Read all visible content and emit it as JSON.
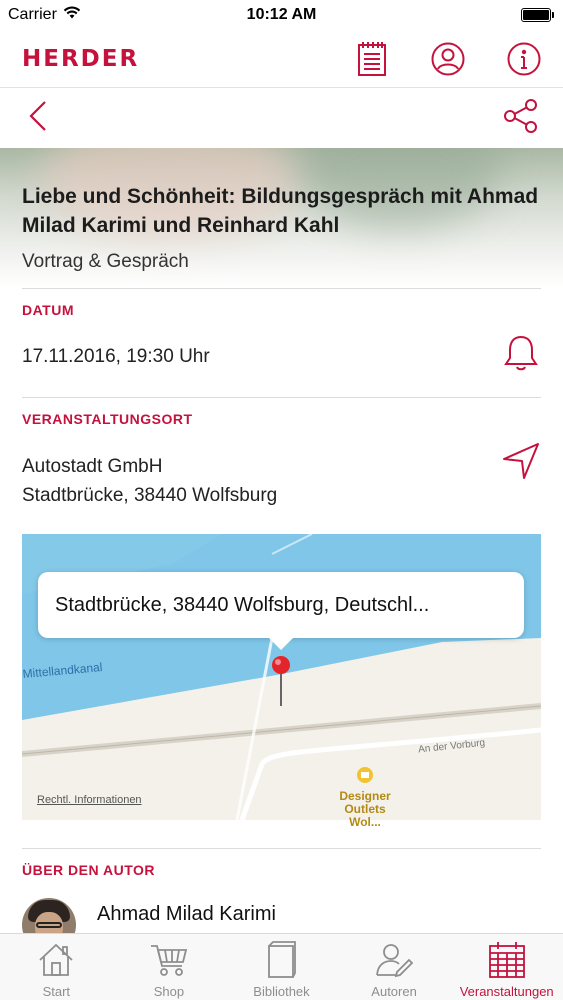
{
  "status_bar": {
    "carrier": "Carrier",
    "time": "10:12 AM",
    "battery_level": 1.0
  },
  "app_bar": {
    "logo": "HERDER",
    "icons": [
      "notepad-icon",
      "profile-icon",
      "info-icon"
    ]
  },
  "nav": {
    "icons": [
      "back-chevron-icon",
      "share-icon"
    ]
  },
  "event": {
    "title": "Liebe und Schönheit: Bildungsgespräch mit Ahmad Milad Karimi und Reinhard Kahl",
    "type": "Vortrag & Gespräch"
  },
  "date_section": {
    "label": "DATUM",
    "value": "17.11.2016, 19:30 Uhr",
    "icon": "bell-icon"
  },
  "venue_section": {
    "label": "VERANSTALTUNGSORT",
    "name": "Autostadt GmbH",
    "address": "Stadtbrücke, 38440 Wolfsburg",
    "icon": "navigation-arrow-icon"
  },
  "map": {
    "callout": "Stadtbrücke, 38440 Wolfsburg, Deutschl...",
    "canal_label": "Mittellandkanal",
    "street_label": "An der Vorburg",
    "poi_label": "Designer Outlets Wol...",
    "legal_link": "Rechtl. Informationen",
    "colors": {
      "water": "#7fc6e8",
      "land": "#f4f1ea",
      "pin": "#e3242b"
    }
  },
  "author_section": {
    "label": "ÜBER DEN AUTOR",
    "name": "Ahmad Milad Karimi"
  },
  "tab_bar": {
    "tabs": [
      {
        "label": "Start",
        "icon": "home-icon",
        "active": false
      },
      {
        "label": "Shop",
        "icon": "cart-icon",
        "active": false
      },
      {
        "label": "Bibliothek",
        "icon": "book-icon",
        "active": false
      },
      {
        "label": "Autoren",
        "icon": "author-icon",
        "active": false
      },
      {
        "label": "Veranstaltungen",
        "icon": "calendar-icon",
        "active": true
      }
    ]
  },
  "colors": {
    "accent": "#c4123d",
    "inactive": "#8e8e8e"
  }
}
